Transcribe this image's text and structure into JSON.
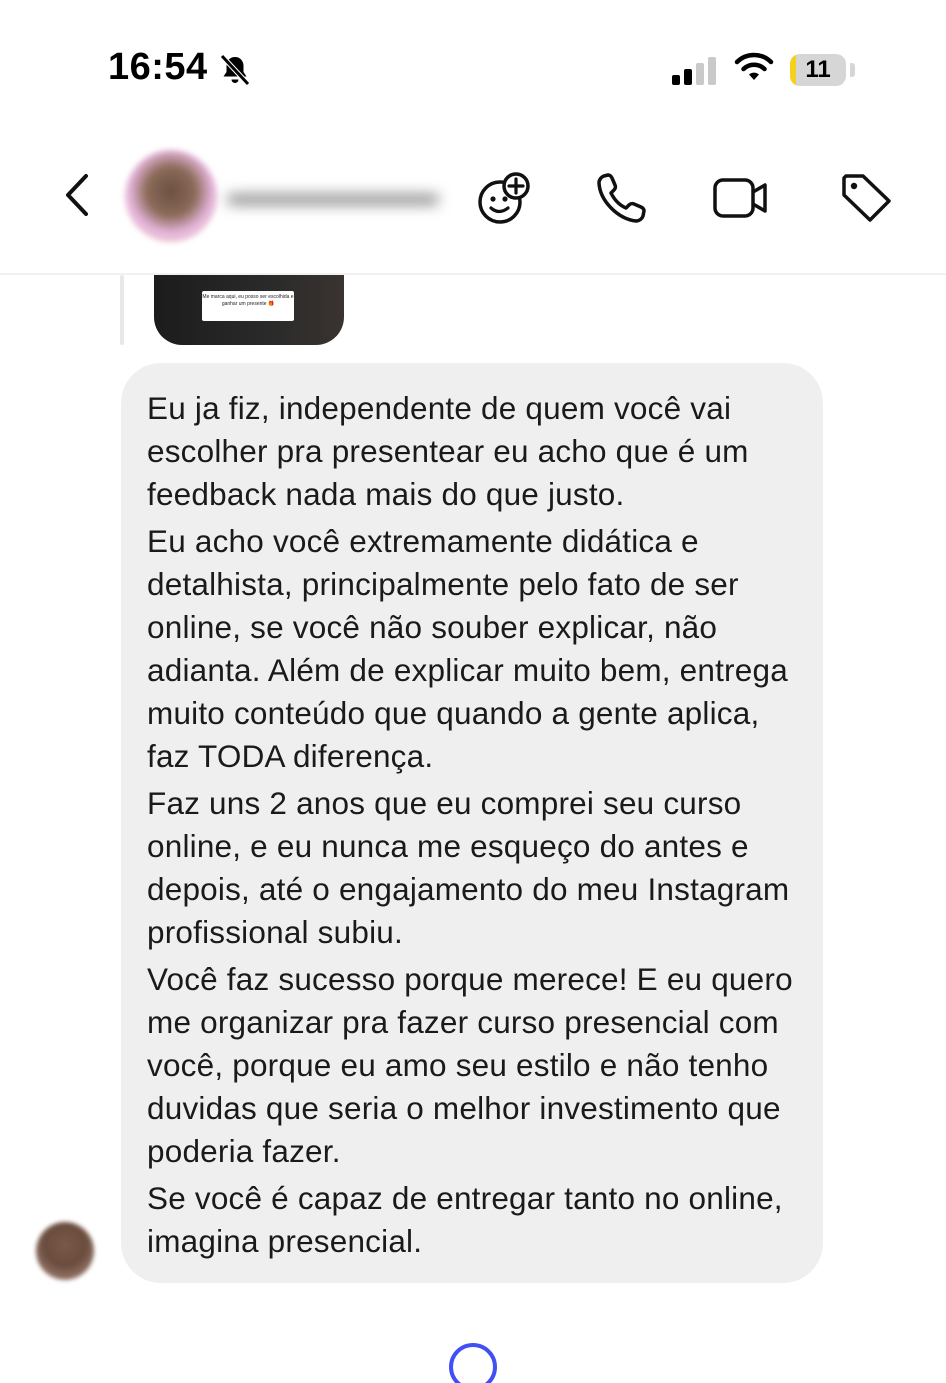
{
  "status_bar": {
    "time": "16:54",
    "battery_level": "11",
    "battery_fraction": 0.11,
    "icons": [
      "bell-slash-icon",
      "cellular-signal-icon",
      "wifi-icon",
      "battery-icon"
    ]
  },
  "header": {
    "icons": [
      "back-chevron-icon",
      "effects-plus-icon",
      "phone-icon",
      "video-camera-icon",
      "tag-icon"
    ]
  },
  "story_preview": {
    "sticker_text": "Me marca aqui, eu posso ser escolhida e ganhar um presente 🎁"
  },
  "message": {
    "paragraphs": [
      "Eu ja fiz, independente de quem você vai escolher pra presentear eu acho que é um feedback nada mais do que justo.",
      "Eu acho você extremamente didática e detalhista, principalmente pelo fato de ser online, se você não souber explicar, não adianta. Além de explicar muito bem, entrega muito conteúdo que quando a gente aplica, faz TODA diferença.",
      "Faz uns 2 anos que eu comprei seu curso online, e eu nunca me esqueço do antes e depois, até o engajamento do meu Instagram profissional subiu.",
      "Você faz sucesso porque merece! E eu quero me organizar pra fazer curso presencial com você, porque eu amo seu estilo e não tenho duvidas que seria o melhor investimento que poderia fazer.",
      "Se você é capaz de entregar tanto no online, imagina presencial."
    ]
  },
  "colors": {
    "bubble": "#efefef",
    "battery_fill": "#f5d021",
    "spinner": "#4150f5"
  }
}
